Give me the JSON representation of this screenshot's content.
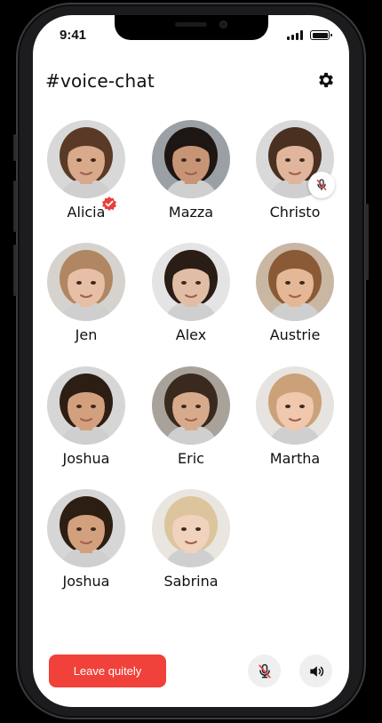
{
  "status_bar": {
    "time": "9:41"
  },
  "header": {
    "title": "#voice-chat",
    "settings_icon": "gear-icon"
  },
  "members": [
    {
      "name": "Alicia",
      "verified": true,
      "muted": false,
      "skin": "#d9a98c",
      "hair": "#5a3a26",
      "bg": "#d8d8d8"
    },
    {
      "name": "Mazza",
      "verified": false,
      "muted": false,
      "skin": "#c79575",
      "hair": "#1e1612",
      "bg": "#9aa0a6"
    },
    {
      "name": "Christo",
      "verified": false,
      "muted": true,
      "skin": "#e0b59c",
      "hair": "#4a3020",
      "bg": "#d9d9d9"
    },
    {
      "name": "Jen",
      "verified": false,
      "muted": false,
      "skin": "#e6bfa6",
      "hair": "#b08762",
      "bg": "#d6d3cf"
    },
    {
      "name": "Alex",
      "verified": false,
      "muted": false,
      "skin": "#e2bda6",
      "hair": "#2a1d16",
      "bg": "#e4e4e4"
    },
    {
      "name": "Austrie",
      "verified": false,
      "muted": false,
      "skin": "#e4b896",
      "hair": "#8a5a36",
      "bg": "#c9b7a3"
    },
    {
      "name": "Joshua",
      "verified": false,
      "muted": false,
      "skin": "#d3a07e",
      "hair": "#2d1e14",
      "bg": "#d6d6d6"
    },
    {
      "name": "Eric",
      "verified": false,
      "muted": false,
      "skin": "#d8aa8c",
      "hair": "#3a2a1e",
      "bg": "#a8a29a"
    },
    {
      "name": "Martha",
      "verified": false,
      "muted": false,
      "skin": "#f0c8ae",
      "hair": "#caa178",
      "bg": "#e6e3e0"
    },
    {
      "name": "Joshua",
      "verified": false,
      "muted": false,
      "skin": "#d3a07e",
      "hair": "#2d1e14",
      "bg": "#d6d6d6"
    },
    {
      "name": "Sabrina",
      "verified": false,
      "muted": false,
      "skin": "#f0d2bd",
      "hair": "#dcc59d",
      "bg": "#e9e5df"
    }
  ],
  "footer": {
    "leave_label": "Leave quitely",
    "mute_icon": "mic-off-icon",
    "speaker_icon": "speaker-icon"
  },
  "colors": {
    "accent": "#f0413a",
    "verified": "#e8403c",
    "button_bg": "#efefef"
  }
}
